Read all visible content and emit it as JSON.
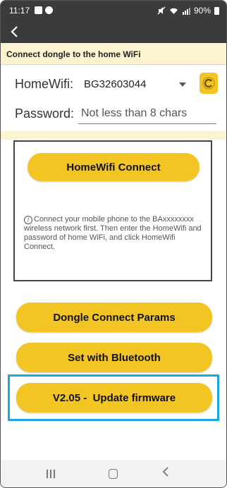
{
  "status_bar": {
    "time": "11:17",
    "battery": "90%"
  },
  "app_bar": {
    "back_icon": "back-arrow-icon"
  },
  "hint": {
    "text": "Connect dongle to the home WiFi"
  },
  "wifi": {
    "label": "HomeWifi:",
    "ssid": "BG32603044",
    "refresh_icon": "refresh-icon"
  },
  "password": {
    "label": "Password:",
    "placeholder": "Not less than 8 chars",
    "value": ""
  },
  "connect_box": {
    "button_label": "HomeWifi Connect",
    "info": "Connect your mobile phone to the BAxxxxxxxx wireless network first. Then enter the HomeWifi and password of home WiFi, and click HomeWifi Connect."
  },
  "buttons": {
    "dongle": "Dongle Connect Params",
    "bluetooth": "Set with Bluetooth",
    "firmware": "V2.05 -  Update firmware"
  },
  "colors": {
    "accent": "#f2c524",
    "highlight": "#1fa6e0",
    "header": "#3b3b3b",
    "cream": "#fdf3cf"
  }
}
